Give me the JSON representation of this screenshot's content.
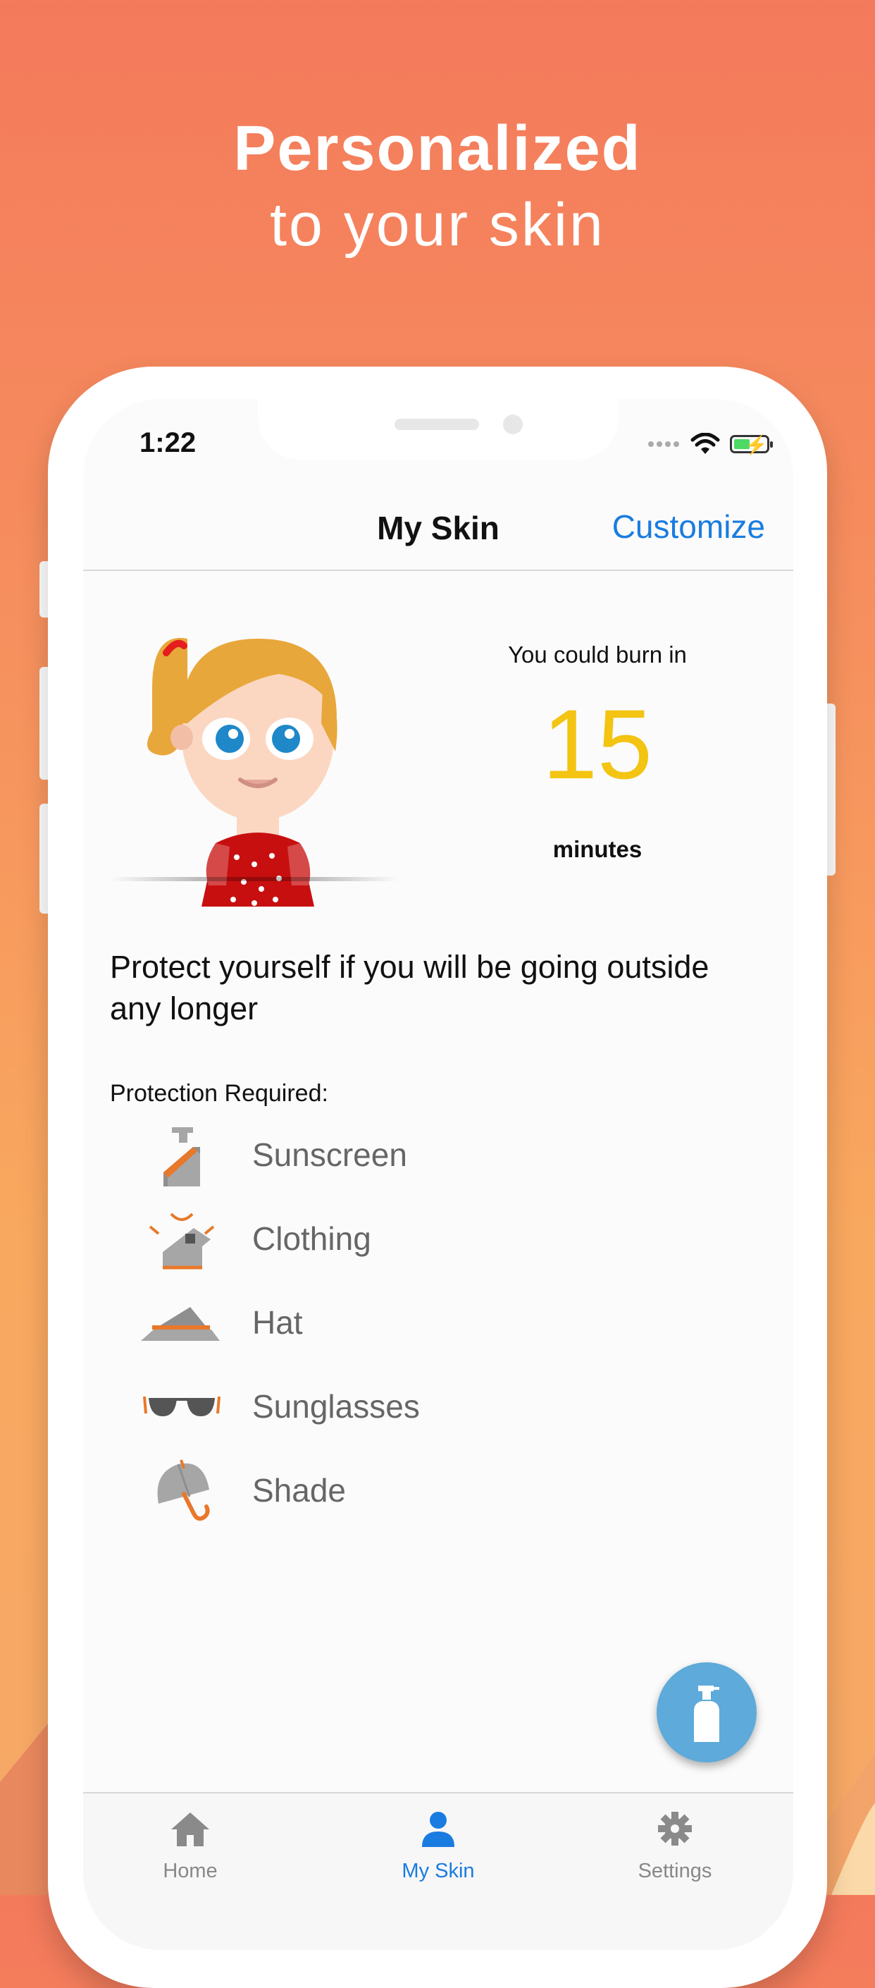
{
  "hero": {
    "line1": "Personalized",
    "line2": "to your skin"
  },
  "status": {
    "time": "1:22"
  },
  "navbar": {
    "title": "My Skin",
    "action": "Customize"
  },
  "burn": {
    "label": "You could burn in",
    "value": "15",
    "unit": "minutes"
  },
  "advice": "Protect yourself if you will be going outside any longer",
  "protection": {
    "label": "Protection Required:",
    "items": [
      {
        "label": "Sunscreen",
        "icon": "sunscreen-icon"
      },
      {
        "label": "Clothing",
        "icon": "clothing-icon"
      },
      {
        "label": "Hat",
        "icon": "hat-icon"
      },
      {
        "label": "Sunglasses",
        "icon": "sunglasses-icon"
      },
      {
        "label": "Shade",
        "icon": "umbrella-icon"
      }
    ]
  },
  "fab": {
    "icon": "sunscreen-bottle-icon"
  },
  "tabs": [
    {
      "label": "Home",
      "icon": "home-icon",
      "active": false
    },
    {
      "label": "My Skin",
      "icon": "person-icon",
      "active": true
    },
    {
      "label": "Settings",
      "icon": "gear-icon",
      "active": false
    }
  ],
  "colors": {
    "accent": "#1a7ce0",
    "burn_value": "#f3c411",
    "fab": "#5eaada",
    "icon_orange": "#e8782a",
    "icon_gray": "#a6a6a6"
  }
}
